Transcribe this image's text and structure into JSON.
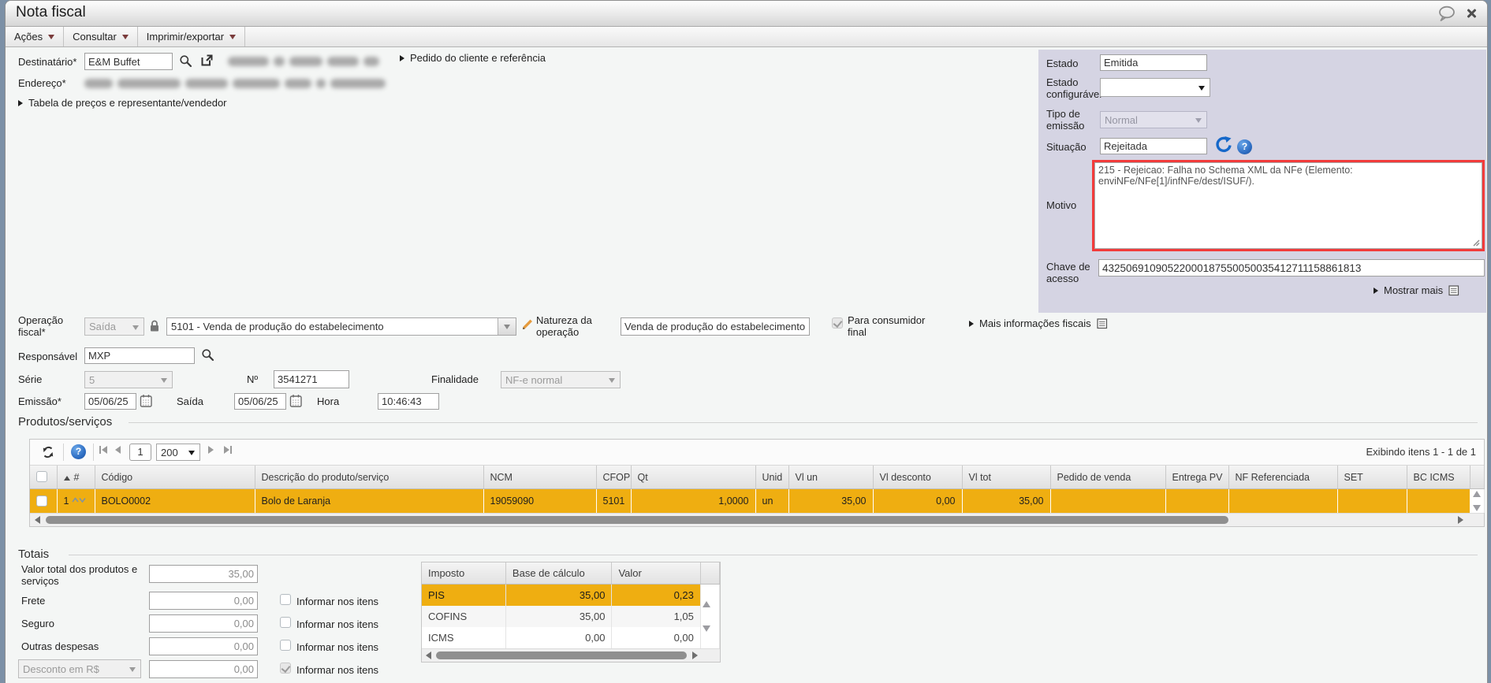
{
  "colors": {
    "orange": "#EFAE11",
    "red": "#F23B3B",
    "panel": "#D5D4E3",
    "blue_icon": "#1668C9",
    "menu_caret": "#7A3B3B"
  },
  "titlebar": {
    "title": "Nota fiscal"
  },
  "menu": {
    "items": [
      {
        "label": "Ações"
      },
      {
        "label": "Consultar"
      },
      {
        "label": "Imprimir/exportar"
      }
    ]
  },
  "destinatario": {
    "label": "Destinatário*",
    "value": "E&M Buffet",
    "pedido_link": "Pedido do cliente e referência"
  },
  "endereco": {
    "label": "Endereço*",
    "tabela_link": "Tabela de preços e representante/vendedor"
  },
  "panel": {
    "estado": {
      "label": "Estado",
      "value": "Emitida"
    },
    "estado_conf": {
      "label": "Estado configurável",
      "value": ""
    },
    "tipo_emissao": {
      "label": "Tipo de emissão",
      "value": "Normal"
    },
    "situacao": {
      "label": "Situação",
      "value": "Rejeitada"
    },
    "motivo": {
      "label": "Motivo",
      "value": "215 - Rejeicao: Falha no Schema XML da NFe (Elemento: enviNFe/NFe[1]/infNFe/dest/ISUF/)."
    },
    "chave": {
      "label": "Chave de acesso",
      "value": "43250691090522000187550050035412711158861813"
    },
    "mostrar_mais": "Mostrar mais"
  },
  "operacao": {
    "label": "Operação fiscal*",
    "tipo": "Saída",
    "cfop": "5101 - Venda de produção do estabelecimento",
    "natureza_label": "Natureza da operação",
    "natureza_value": "Venda de produção do estabelecimento",
    "consumidor_final": "Para consumidor final",
    "mais_info": "Mais informações fiscais",
    "responsavel_label": "Responsável",
    "responsavel_value": "MXP",
    "serie_label": "Série",
    "serie_value": "5",
    "numero_label": "Nº",
    "numero_value": "3541271",
    "finalidade_label": "Finalidade",
    "finalidade_value": "NF-e normal",
    "emissao_label": "Emissão*",
    "emissao_value": "05/06/25",
    "saida_label": "Saída",
    "saida_value": "05/06/25",
    "hora_label": "Hora",
    "hora_value": "10:46:43"
  },
  "produtos": {
    "section": "Produtos/serviços",
    "toolbar": {
      "page": "1",
      "page_size": "200",
      "status": "Exibindo itens 1 - 1 de 1"
    },
    "headers": [
      "#",
      "Código",
      "Descrição do produto/serviço",
      "NCM",
      "CFOP",
      "Qt",
      "Unid",
      "Vl un",
      "Vl desconto",
      "Vl tot",
      "Pedido de venda",
      "Entrega PV",
      "NF Referenciada",
      "SET",
      "BC ICMS"
    ],
    "row": {
      "num": "1",
      "codigo": "BOLO0002",
      "descricao": "Bolo de Laranja",
      "ncm": "19059090",
      "cfop": "5101",
      "qt": "1,0000",
      "unid": "un",
      "vl_un": "35,00",
      "vl_desconto": "0,00",
      "vl_tot": "35,00",
      "pedido_venda": "",
      "entrega_pv": "",
      "nf_ref": "",
      "set": "",
      "bc_icms": ""
    }
  },
  "totais": {
    "section": "Totais",
    "informar": "Informar nos itens",
    "rows": [
      {
        "label": "Valor total dos produtos e serviços",
        "value": "35,00"
      },
      {
        "label": "Frete",
        "value": "0,00"
      },
      {
        "label": "Seguro",
        "value": "0,00"
      },
      {
        "label": "Outras despesas",
        "value": "0,00"
      },
      {
        "label": "Desconto em R$",
        "value": "0,00"
      }
    ]
  },
  "impostos": {
    "headers": [
      "Imposto",
      "Base de cálculo",
      "Valor"
    ],
    "rows": [
      {
        "name": "PIS",
        "base": "35,00",
        "valor": "0,23"
      },
      {
        "name": "COFINS",
        "base": "35,00",
        "valor": "1,05"
      },
      {
        "name": "ICMS",
        "base": "0,00",
        "valor": "0,00"
      }
    ]
  },
  "ui": {
    "help_glyph": "?"
  }
}
